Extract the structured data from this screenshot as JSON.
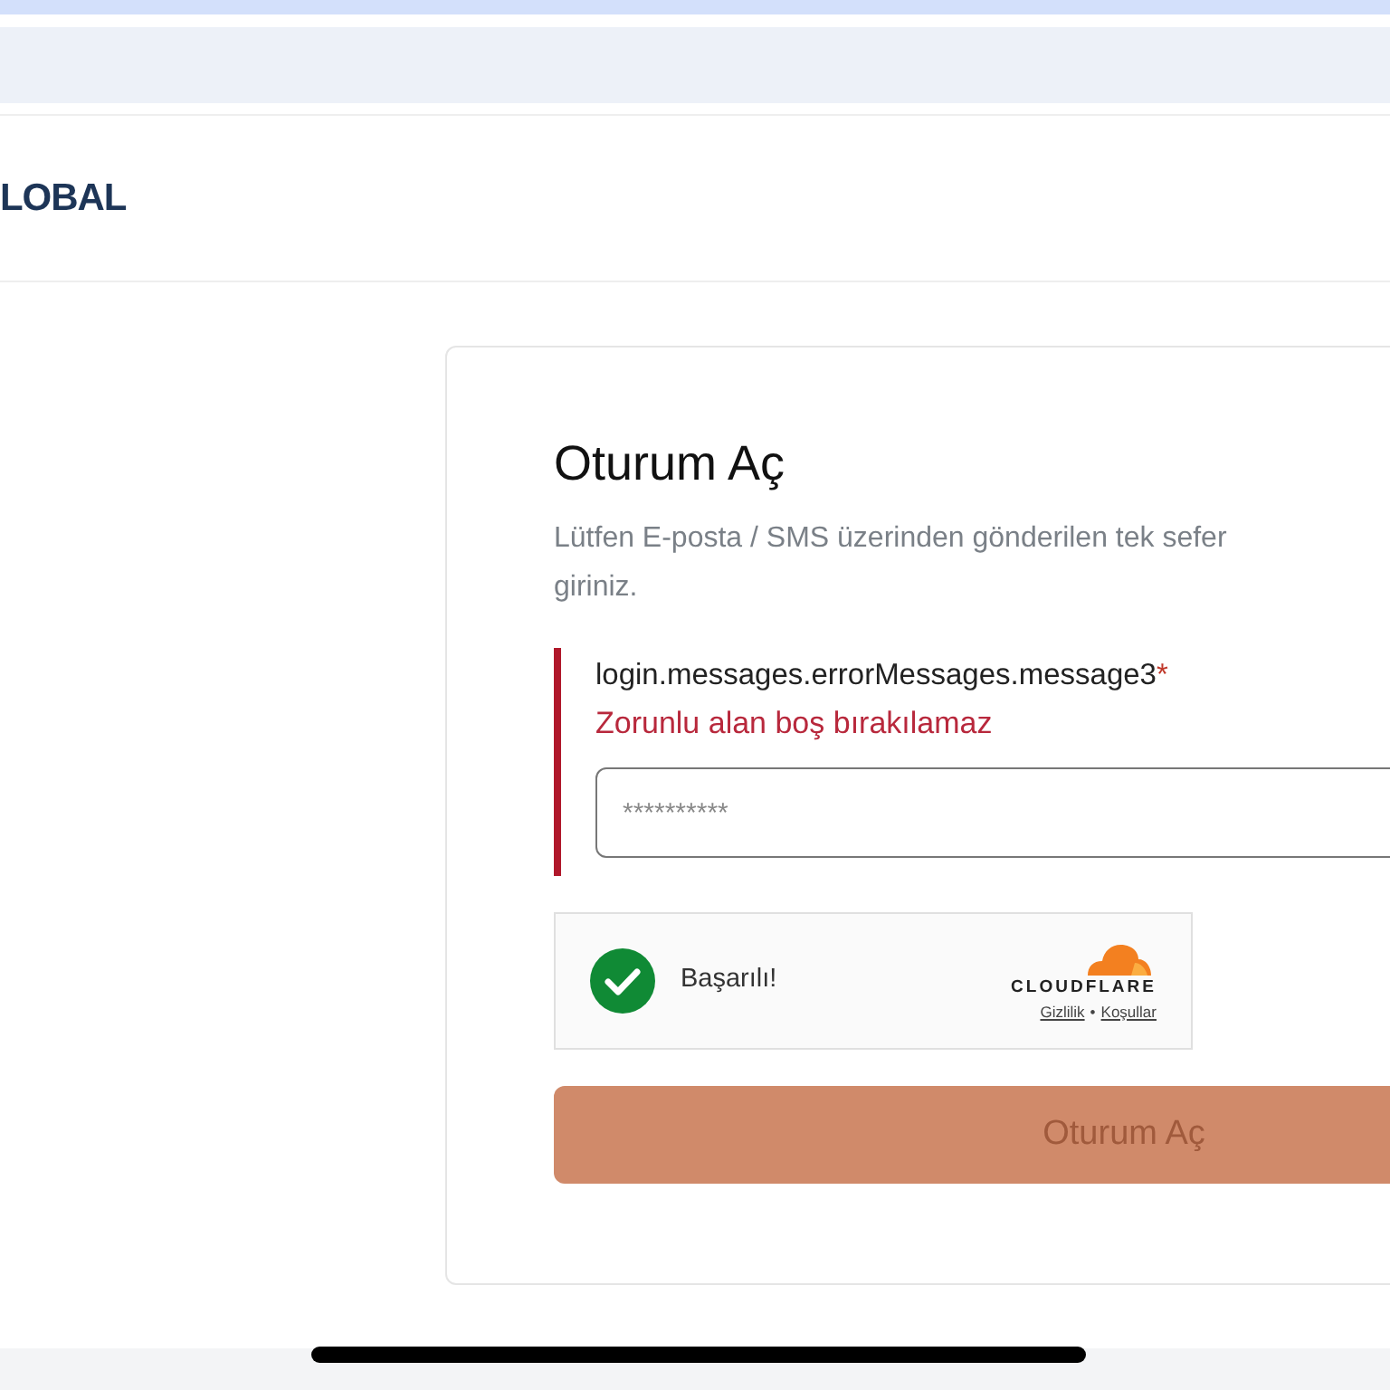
{
  "header": {
    "logo": "LOBAL"
  },
  "login": {
    "title": "Oturum Aç",
    "subtitle_lines": [
      "Lütfen E-posta / SMS üzerinden gönderilen tek sefer",
      "giriniz."
    ],
    "field": {
      "label": "login.messages.errorMessages.message3",
      "required": true,
      "required_mark": "*",
      "invalid": true,
      "error": "Zorunlu alan boş bırakılamaz",
      "placeholder": "**********"
    },
    "captcha": {
      "success": true,
      "status": "Başarılı!",
      "brand": "CLOUDFLARE",
      "links": [
        "Gizlilik",
        "Koşullar"
      ],
      "separator": "•"
    },
    "submit": {
      "label": "Oturum Aç",
      "disabled": true
    }
  }
}
